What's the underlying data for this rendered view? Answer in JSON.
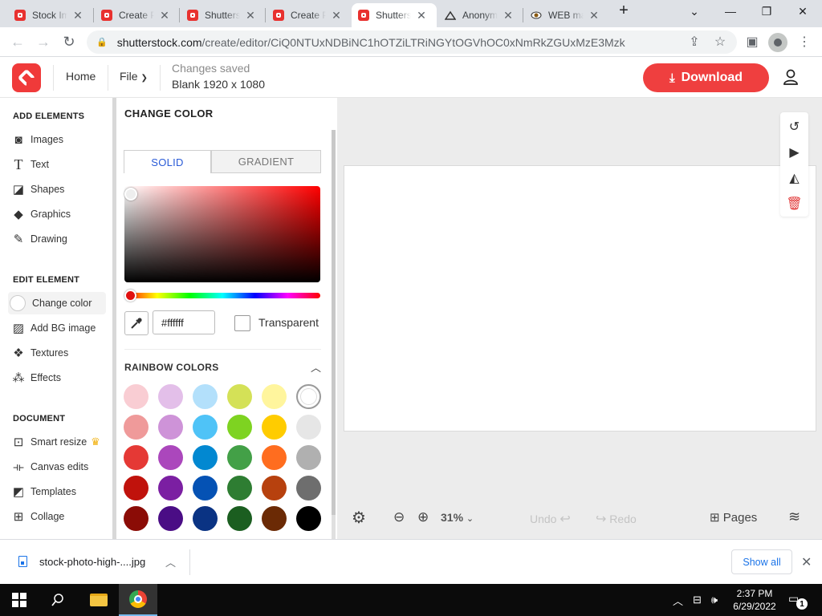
{
  "browser": {
    "tabs": [
      {
        "label": "Stock Im",
        "active": false
      },
      {
        "label": "Create P",
        "active": false
      },
      {
        "label": "Shutters",
        "active": false
      },
      {
        "label": "Create P",
        "active": false
      },
      {
        "label": "Shutters",
        "active": true
      },
      {
        "label": "Anonym",
        "active": false
      },
      {
        "label": "WEB ma",
        "active": false
      }
    ],
    "url_domain": "shutterstock.com",
    "url_path": "/create/editor/CiQ0NTUxNDBiNC1hOTZiLTRiNGYtOGVhOC0xNmRkZGUxMzE3Mzk"
  },
  "app": {
    "home_label": "Home",
    "file_label": "File",
    "status": "Changes saved",
    "doc_size": "Blank 1920 x 1080",
    "download_label": "Download",
    "brand_color": "#ef3f3f"
  },
  "sidebar": {
    "add_elements_header": "ADD ELEMENTS",
    "add_elements": [
      {
        "label": "Images",
        "icon": "camera-icon"
      },
      {
        "label": "Text",
        "icon": "text-icon"
      },
      {
        "label": "Shapes",
        "icon": "shapes-icon"
      },
      {
        "label": "Graphics",
        "icon": "graphics-icon"
      },
      {
        "label": "Drawing",
        "icon": "pen-icon"
      }
    ],
    "edit_element_header": "EDIT ELEMENT",
    "edit_element": [
      {
        "label": "Change color",
        "icon": "color-circle-icon"
      },
      {
        "label": "Add BG image",
        "icon": "image-icon"
      },
      {
        "label": "Textures",
        "icon": "texture-icon"
      },
      {
        "label": "Effects",
        "icon": "effects-icon"
      }
    ],
    "document_header": "DOCUMENT",
    "document": [
      {
        "label": "Smart resize",
        "icon": "resize-icon"
      },
      {
        "label": "Canvas edits",
        "icon": "canvas-edits-icon"
      },
      {
        "label": "Templates",
        "icon": "templates-icon"
      },
      {
        "label": "Collage",
        "icon": "collage-icon"
      }
    ]
  },
  "color_panel": {
    "title": "CHANGE COLOR",
    "tab_solid": "SOLID",
    "tab_gradient": "GRADIENT",
    "hex_value": "#ffffff",
    "transparent_label": "Transparent",
    "transparent_checked": false,
    "rainbow_header": "RAINBOW COLORS",
    "swatches": [
      [
        "#f9cdd3",
        "#e3bfe9",
        "#b3e0fb",
        "#d4e157",
        "#fff59d",
        "#ffffff"
      ],
      [
        "#ef9a9a",
        "#ce93d8",
        "#4fc3f7",
        "#7ed321",
        "#ffcc00",
        "#e6e6e6"
      ],
      [
        "#e53935",
        "#ab47bc",
        "#0288d1",
        "#43a047",
        "#ff6d1f",
        "#b0b0b0"
      ],
      [
        "#c0120c",
        "#7b1fa2",
        "#0552b4",
        "#2e7d32",
        "#b7410e",
        "#6e6e6e"
      ],
      [
        "#8b0c06",
        "#4a0d85",
        "#0a3383",
        "#1b5e20",
        "#6b2a05",
        "#000000"
      ]
    ],
    "selected_swatch": "#ffffff"
  },
  "bottom_bar": {
    "zoom": "31%",
    "undo_label": "Undo",
    "redo_label": "Redo",
    "pages_label": "Pages"
  },
  "download_shelf": {
    "filename": "stock-photo-high-....jpg",
    "show_all_label": "Show all"
  },
  "taskbar": {
    "time": "2:37 PM",
    "date": "6/29/2022",
    "notifications": "1"
  }
}
